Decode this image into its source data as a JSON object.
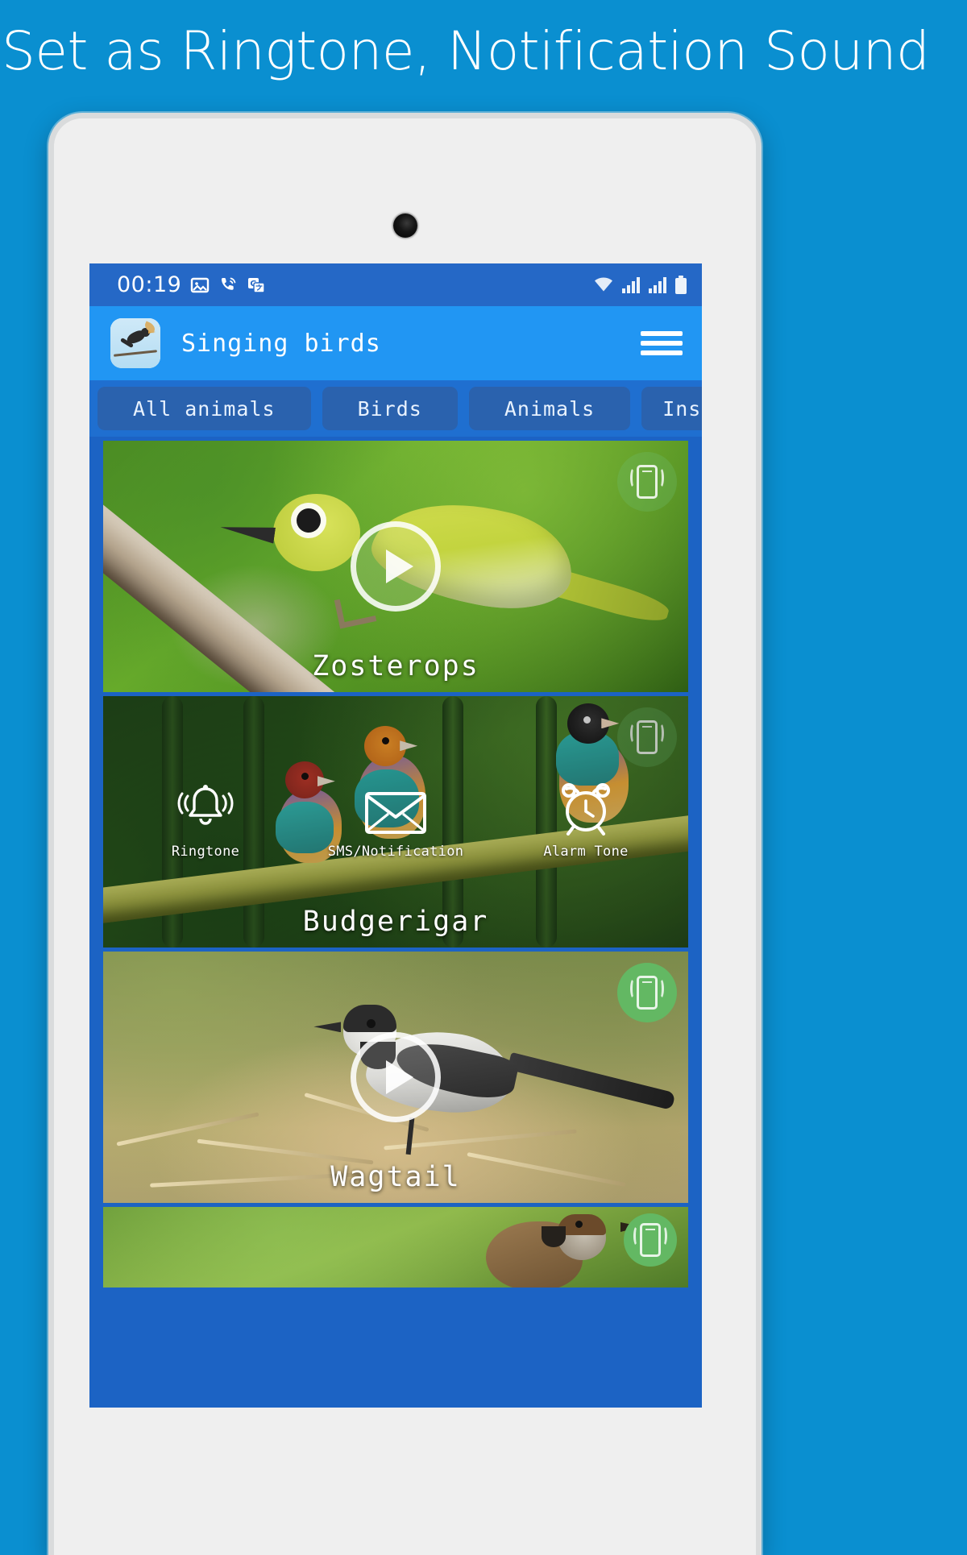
{
  "promo": {
    "headline": "Set as Ringtone, Notification Sound",
    "background_color": "#0a8fd0",
    "headline_color": "#ffffff"
  },
  "device": {
    "frame_color": "#d9dbdc",
    "body_color": "#efefef",
    "camera": "front-camera-dot"
  },
  "app": {
    "status_bar": {
      "time": "00:19",
      "left_icons": [
        "image-icon",
        "call-sound-icon",
        "translate-icon"
      ],
      "right_icons": [
        "wifi-icon",
        "signal-icon",
        "signal-icon",
        "battery-icon"
      ],
      "background_color": "#2568c6"
    },
    "app_bar": {
      "icon": "app-bird-icon",
      "title": "Singing birds",
      "menu_icon": "hamburger-menu-icon",
      "background_color": "#2196f3"
    },
    "tabs": {
      "background_color": "#1f6fd0",
      "chip_color": "#2a62ae",
      "items": [
        {
          "label": "All animals",
          "selected": false
        },
        {
          "label": "Birds",
          "selected": false
        },
        {
          "label": "Animals",
          "selected": false
        },
        {
          "label": "Insect",
          "selected": false
        }
      ]
    },
    "ringtone_overlay": {
      "options": [
        {
          "label": "Ringtone",
          "icon": "bell-icon"
        },
        {
          "label": "SMS/Notification",
          "icon": "envelope-icon"
        },
        {
          "label": "Alarm Tone",
          "icon": "alarm-clock-icon"
        }
      ]
    },
    "cards": [
      {
        "name": "Zosterops",
        "play_icon": "play-icon",
        "badge_icon": "vibrate-phone-icon",
        "badge_style": "ghost",
        "overlay_open": false
      },
      {
        "name": "Budgerigar",
        "play_icon": "play-icon",
        "badge_icon": "vibrate-phone-icon",
        "badge_style": "ghost",
        "overlay_open": true
      },
      {
        "name": "Wagtail",
        "play_icon": "play-icon",
        "badge_icon": "vibrate-phone-icon",
        "badge_style": "solid",
        "overlay_open": false
      },
      {
        "name": "",
        "play_icon": "play-icon",
        "badge_icon": "vibrate-phone-icon",
        "badge_style": "solid",
        "overlay_open": false
      }
    ]
  }
}
